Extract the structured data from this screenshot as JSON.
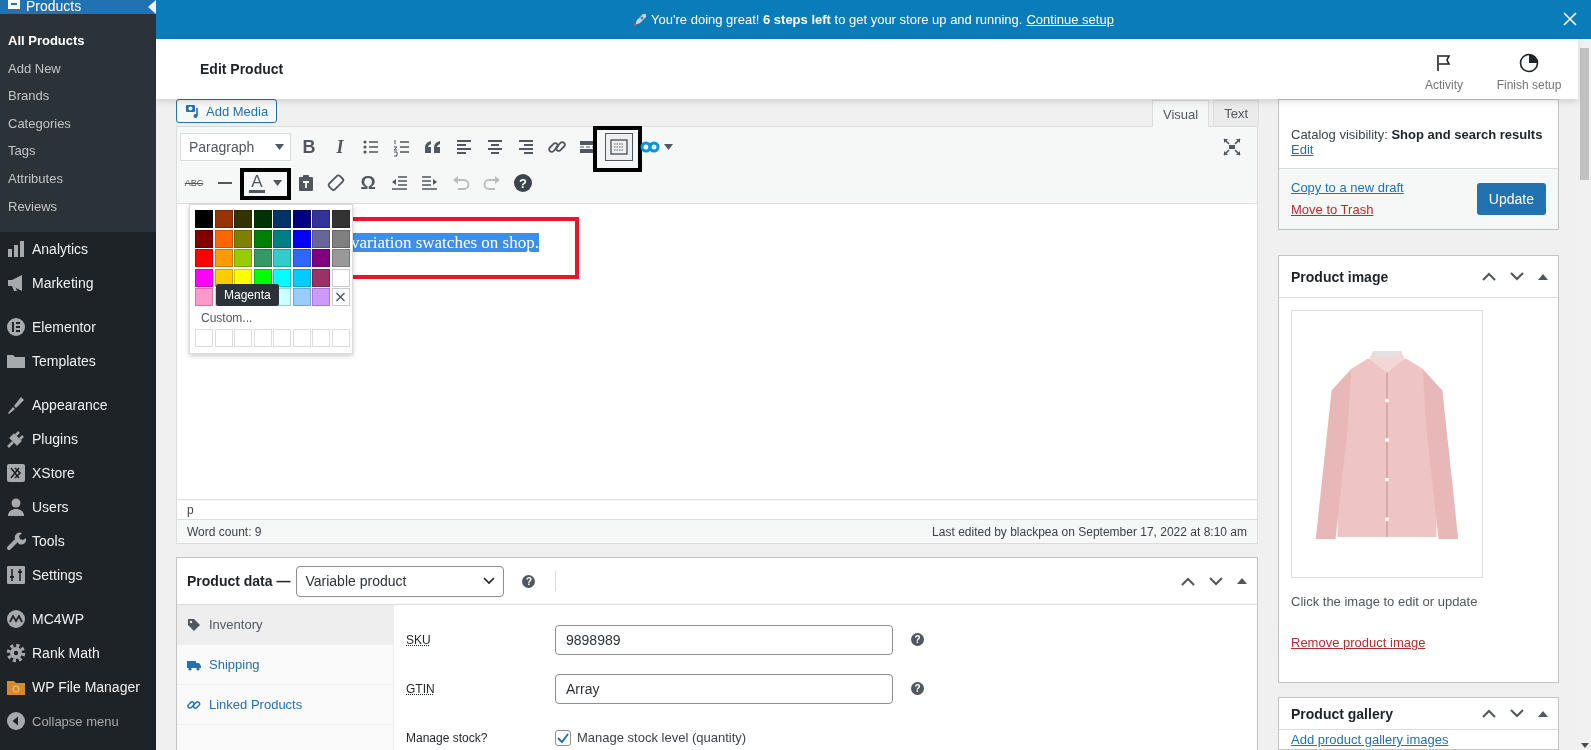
{
  "sidebar": {
    "current": {
      "label": "Products",
      "selected": true
    },
    "submenu": [
      {
        "label": "All Products",
        "selected": true
      },
      {
        "label": "Add New",
        "selected": false
      },
      {
        "label": "Brands",
        "selected": false
      },
      {
        "label": "Categories",
        "selected": false
      },
      {
        "label": "Tags",
        "selected": false
      },
      {
        "label": "Attributes",
        "selected": false
      },
      {
        "label": "Reviews",
        "selected": false
      }
    ],
    "menu_groups": [
      [
        {
          "kind": "item",
          "label": "Analytics"
        },
        {
          "kind": "item",
          "label": "Marketing"
        }
      ],
      [
        {
          "kind": "item",
          "label": "Elementor"
        },
        {
          "kind": "item",
          "label": "Templates"
        }
      ],
      [
        {
          "kind": "item",
          "label": "Appearance"
        },
        {
          "kind": "item",
          "label": "Plugins"
        },
        {
          "kind": "item",
          "label": "XStore"
        },
        {
          "kind": "item",
          "label": "Users"
        },
        {
          "kind": "item",
          "label": "Tools"
        },
        {
          "kind": "item",
          "label": "Settings"
        }
      ],
      [
        {
          "kind": "item",
          "label": "MC4WP"
        },
        {
          "kind": "item",
          "label": "Rank Math"
        },
        {
          "kind": "item",
          "label": "WP File Manager"
        },
        {
          "kind": "collapse",
          "label": "Collapse menu"
        }
      ]
    ]
  },
  "banner": {
    "message": "You're doing great! **6 steps left** to get your store up and running.",
    "link": "Continue setup"
  },
  "header": {
    "title": "Edit Product",
    "actions": [
      {
        "label": "Activity"
      },
      {
        "label": "Finish setup"
      }
    ]
  },
  "editor": {
    "add_media": "Add Media",
    "tabs": [
      {
        "label": "Visual",
        "selected": true
      },
      {
        "label": "Text",
        "selected": false
      }
    ],
    "format_select": "Paragraph",
    "toolbar_rows": [
      [
        {
          "kind": "bold",
          "label": "B",
          "pressed": false,
          "disabled": false,
          "annotated": false
        },
        {
          "kind": "italic",
          "label": "I",
          "pressed": false,
          "disabled": false,
          "annotated": false
        },
        {
          "kind": "bullets",
          "pressed": false,
          "disabled": false,
          "annotated": false
        },
        {
          "kind": "numbers",
          "pressed": false,
          "disabled": false,
          "annotated": false
        },
        {
          "kind": "quote",
          "pressed": false,
          "disabled": false,
          "annotated": false
        },
        {
          "kind": "align-left",
          "pressed": false,
          "disabled": false,
          "annotated": false
        },
        {
          "kind": "align-center",
          "pressed": false,
          "disabled": false,
          "annotated": false
        },
        {
          "kind": "align-right",
          "pressed": false,
          "disabled": false,
          "annotated": false
        },
        {
          "kind": "link",
          "pressed": false,
          "disabled": false,
          "annotated": false
        },
        {
          "kind": "more",
          "pressed": false,
          "disabled": false,
          "annotated": false
        },
        {
          "kind": "toggle",
          "pressed": true,
          "disabled": false,
          "annotated": true
        },
        {
          "kind": "infinity",
          "pressed": false,
          "disabled": false,
          "annotated": false
        },
        {
          "kind": "fullscreen",
          "pressed": false,
          "disabled": false,
          "annotated": false
        }
      ],
      [
        {
          "kind": "strike",
          "label": "ABC",
          "pressed": false,
          "disabled": false,
          "annotated": false
        },
        {
          "kind": "hr",
          "pressed": false,
          "disabled": false,
          "annotated": false
        },
        {
          "kind": "textcolor",
          "label": "A",
          "pressed": false,
          "disabled": false,
          "annotated": true
        },
        {
          "kind": "paste",
          "pressed": false,
          "disabled": false,
          "annotated": false
        },
        {
          "kind": "eraser",
          "pressed": false,
          "disabled": false,
          "annotated": false
        },
        {
          "kind": "char",
          "label": "Ω",
          "pressed": false,
          "disabled": false,
          "annotated": false
        },
        {
          "kind": "outdent",
          "pressed": false,
          "disabled": false,
          "annotated": false
        },
        {
          "kind": "indent",
          "pressed": false,
          "disabled": false,
          "annotated": false
        },
        {
          "kind": "undo",
          "pressed": false,
          "disabled": true,
          "annotated": false
        },
        {
          "kind": "redo",
          "pressed": false,
          "disabled": true,
          "annotated": false
        },
        {
          "kind": "help",
          "label": "?",
          "pressed": false,
          "disabled": false,
          "annotated": false
        }
      ]
    ],
    "content": {
      "text": "variation swatches on shop.",
      "selected": true,
      "annotated": true
    },
    "path": "p",
    "word_count": "Word count: 9",
    "last_edited": "Last edited by blackpea on September 17, 2022 at 8:10 am"
  },
  "color_picker": {
    "swatches": [
      {
        "kind": "color",
        "color": "#000000"
      },
      {
        "kind": "color",
        "color": "#993300"
      },
      {
        "kind": "color",
        "color": "#333300"
      },
      {
        "kind": "color",
        "color": "#003300"
      },
      {
        "kind": "color",
        "color": "#003366"
      },
      {
        "kind": "color",
        "color": "#000080"
      },
      {
        "kind": "color",
        "color": "#333399"
      },
      {
        "kind": "color",
        "color": "#333333"
      },
      {
        "kind": "color",
        "color": "#800000"
      },
      {
        "kind": "color",
        "color": "#ff6600"
      },
      {
        "kind": "color",
        "color": "#808000"
      },
      {
        "kind": "color",
        "color": "#008000"
      },
      {
        "kind": "color",
        "color": "#008080"
      },
      {
        "kind": "color",
        "color": "#0000ff"
      },
      {
        "kind": "color",
        "color": "#666699"
      },
      {
        "kind": "color",
        "color": "#808080"
      },
      {
        "kind": "color",
        "color": "#ff0000"
      },
      {
        "kind": "color",
        "color": "#ff9900"
      },
      {
        "kind": "color",
        "color": "#99cc00"
      },
      {
        "kind": "color",
        "color": "#339966"
      },
      {
        "kind": "color",
        "color": "#33cccc"
      },
      {
        "kind": "color",
        "color": "#3366ff"
      },
      {
        "kind": "color",
        "color": "#800080"
      },
      {
        "kind": "color",
        "color": "#999999"
      },
      {
        "kind": "color",
        "color": "#ff00ff"
      },
      {
        "kind": "color",
        "color": "#ffcc00"
      },
      {
        "kind": "color",
        "color": "#ffff00"
      },
      {
        "kind": "color",
        "color": "#00ff00"
      },
      {
        "kind": "color",
        "color": "#00ffff"
      },
      {
        "kind": "color",
        "color": "#00ccff"
      },
      {
        "kind": "color",
        "color": "#993366"
      },
      {
        "kind": "color",
        "color": "#ffffff"
      },
      {
        "kind": "color",
        "color": "#ff99cc"
      },
      {
        "kind": "covered"
      },
      {
        "kind": "covered"
      },
      {
        "kind": "covered"
      },
      {
        "kind": "color",
        "color": "#ccffff"
      },
      {
        "kind": "color",
        "color": "#99ccff"
      },
      {
        "kind": "color",
        "color": "#cc99ff"
      },
      {
        "kind": "remove",
        "label": "×"
      }
    ],
    "tooltip": "Magenta",
    "custom": "Custom..."
  },
  "product_data": {
    "title": "Product data —",
    "type": "Variable product",
    "help": "?",
    "tabs": [
      {
        "label": "Inventory",
        "selected": true
      },
      {
        "label": "Shipping",
        "selected": false
      },
      {
        "label": "Linked Products",
        "selected": false
      }
    ],
    "fields": [
      {
        "kind": "text",
        "label": "SKU",
        "value": "9898989",
        "help": "?"
      },
      {
        "kind": "text",
        "label": "GTIN",
        "value": "Array",
        "help": "?"
      },
      {
        "kind": "checkbox",
        "label": "Manage stock?",
        "option": "Manage stock level (quantity)",
        "checked": true
      }
    ]
  },
  "publish": {
    "visibility": "Catalog visibility: **Shop and search results**",
    "edit": "Edit",
    "copy": "Copy to a new draft",
    "trash": "Move to Trash",
    "update": "Update"
  },
  "product_image": {
    "title": "Product image",
    "hint": "Click the image to edit or update",
    "remove": "Remove product image"
  },
  "product_gallery": {
    "title": "Product gallery",
    "add": "Add product gallery images"
  }
}
